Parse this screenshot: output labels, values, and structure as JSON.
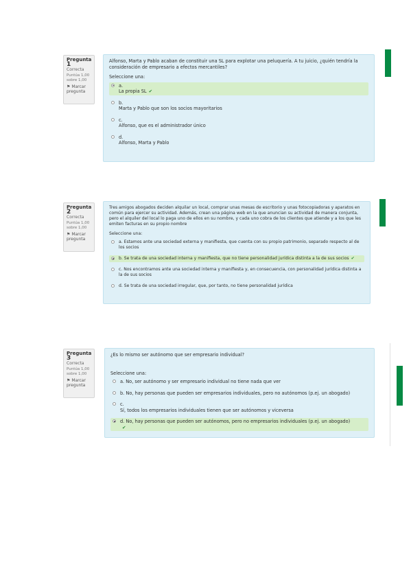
{
  "questions": [
    {
      "label": "Pregunta",
      "number": "1",
      "state": "Correcta",
      "grade": "Puntúa 1,00 sobre 1,00",
      "flag": "Marcar pregunta",
      "text": "Alfonso, Marta y Pablo acaban de constituir una SL para explotar una peluquería. A tu juicio, ¿quién tendría la consideración de empresario a efectos mercantiles?",
      "prompt": "Seleccione una:",
      "options": [
        {
          "letter": "a.",
          "text": "La propia SL",
          "correct": true
        },
        {
          "letter": "b.",
          "text": "Marta y Pablo que son los socios mayoritarios",
          "correct": false
        },
        {
          "letter": "c.",
          "text": "Alfonso, que es el administrador único",
          "correct": false
        },
        {
          "letter": "d.",
          "text": "Alfonso, Marta y Pablo",
          "correct": false
        }
      ]
    },
    {
      "label": "Pregunta",
      "number": "2",
      "state": "Correcta",
      "grade": "Puntúa 1,00 sobre 1,00",
      "flag": "Marcar pregunta",
      "text": "Tres amigos abogados deciden alquilar un local, comprar unas mesas de escritorio y unas fotocopiadoras y aparatos en común para ejercer su actividad. Además, crean una página web en la que anuncian su actividad de manera conjunta, pero el alquiler del local lo paga uno de ellos en su nombre, y cada uno cobra de los clientes que atiende y a los que les emiten facturas en su propio nombre",
      "prompt": "Seleccione una:",
      "options": [
        {
          "letter": "a.",
          "text": "Estamos ante una sociedad externa y manifiesta, que cuenta con su propio patrimonio, separado respecto al de los socios",
          "correct": false
        },
        {
          "letter": "b.",
          "text": "Se trata de una sociedad interna y manifiesta, que no tiene personalidad jurídica distinta a la de sus socios",
          "correct": true
        },
        {
          "letter": "c.",
          "text": "Nos encontramos ante una sociedad interna y manifiesta y, en consecuencia, con personalidad jurídica distinta a la de sus socios",
          "correct": false
        },
        {
          "letter": "d.",
          "text": "Se trata de una sociedad irregular, que, por tanto, no tiene personalidad jurídica",
          "correct": false
        }
      ]
    },
    {
      "label": "Pregunta",
      "number": "3",
      "state": "Correcta",
      "grade": "Puntúa 1,00 sobre 1,00",
      "flag": "Marcar pregunta",
      "text": "¿Es lo mismo ser autónomo que ser empresario individual?",
      "prompt": "Seleccione una:",
      "options": [
        {
          "letter": "a.",
          "text": "No, ser autónomo y ser empresario individual no tiene nada que ver",
          "correct": false
        },
        {
          "letter": "b.",
          "text": "No, hay personas que pueden ser empresarios individuales, pero no autónomos (p.ej. un abogado)",
          "correct": false
        },
        {
          "letter": "c.",
          "text": "Sí, todos los empresarios individuales tienen que ser autónomos y viceversa",
          "correct": false
        },
        {
          "letter": "d.",
          "text": "No, hay personas que pueden ser autónomos, pero no empresarios individuales (p.ej. un abogado)",
          "correct": true
        }
      ]
    }
  ],
  "colors": {
    "accent": "#068a44",
    "question_bg": "#dff0f7",
    "selected_bg": "#d6eec9",
    "check": "#2d8a3a"
  },
  "icons": {
    "check": "check-icon",
    "flag": "flag-icon"
  }
}
